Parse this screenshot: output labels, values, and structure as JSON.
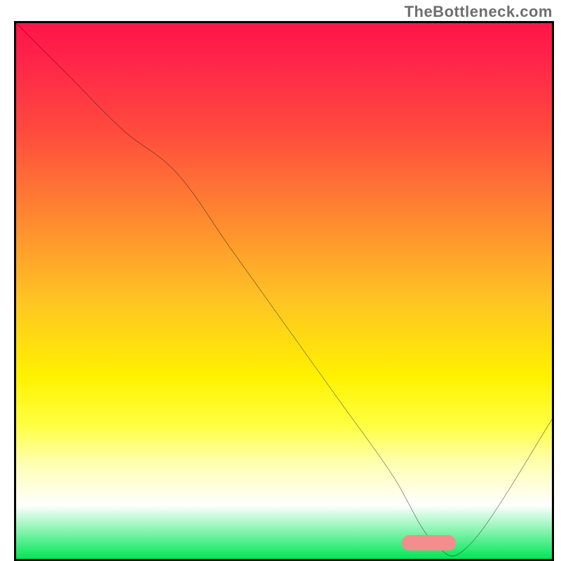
{
  "watermark": "TheBottleneck.com",
  "chart_data": {
    "type": "line",
    "title": "",
    "xlabel": "",
    "ylabel": "",
    "xlim": [
      0,
      100
    ],
    "ylim": [
      0,
      100
    ],
    "grid": false,
    "legend": false,
    "series": [
      {
        "name": "curve",
        "x": [
          0,
          10,
          20,
          30,
          40,
          50,
          60,
          70,
          78,
          85,
          100
        ],
        "y": [
          100,
          90,
          80,
          72,
          58,
          44,
          30,
          16,
          3,
          3,
          26
        ]
      }
    ],
    "marker": {
      "x_start": 72,
      "x_end": 82,
      "y": 3
    },
    "background_gradient": {
      "top": "#ff1648",
      "upper_mid": "#ff8f2e",
      "mid": "#fff200",
      "lower_mid": "#ffffff",
      "bottom": "#00e756"
    }
  }
}
